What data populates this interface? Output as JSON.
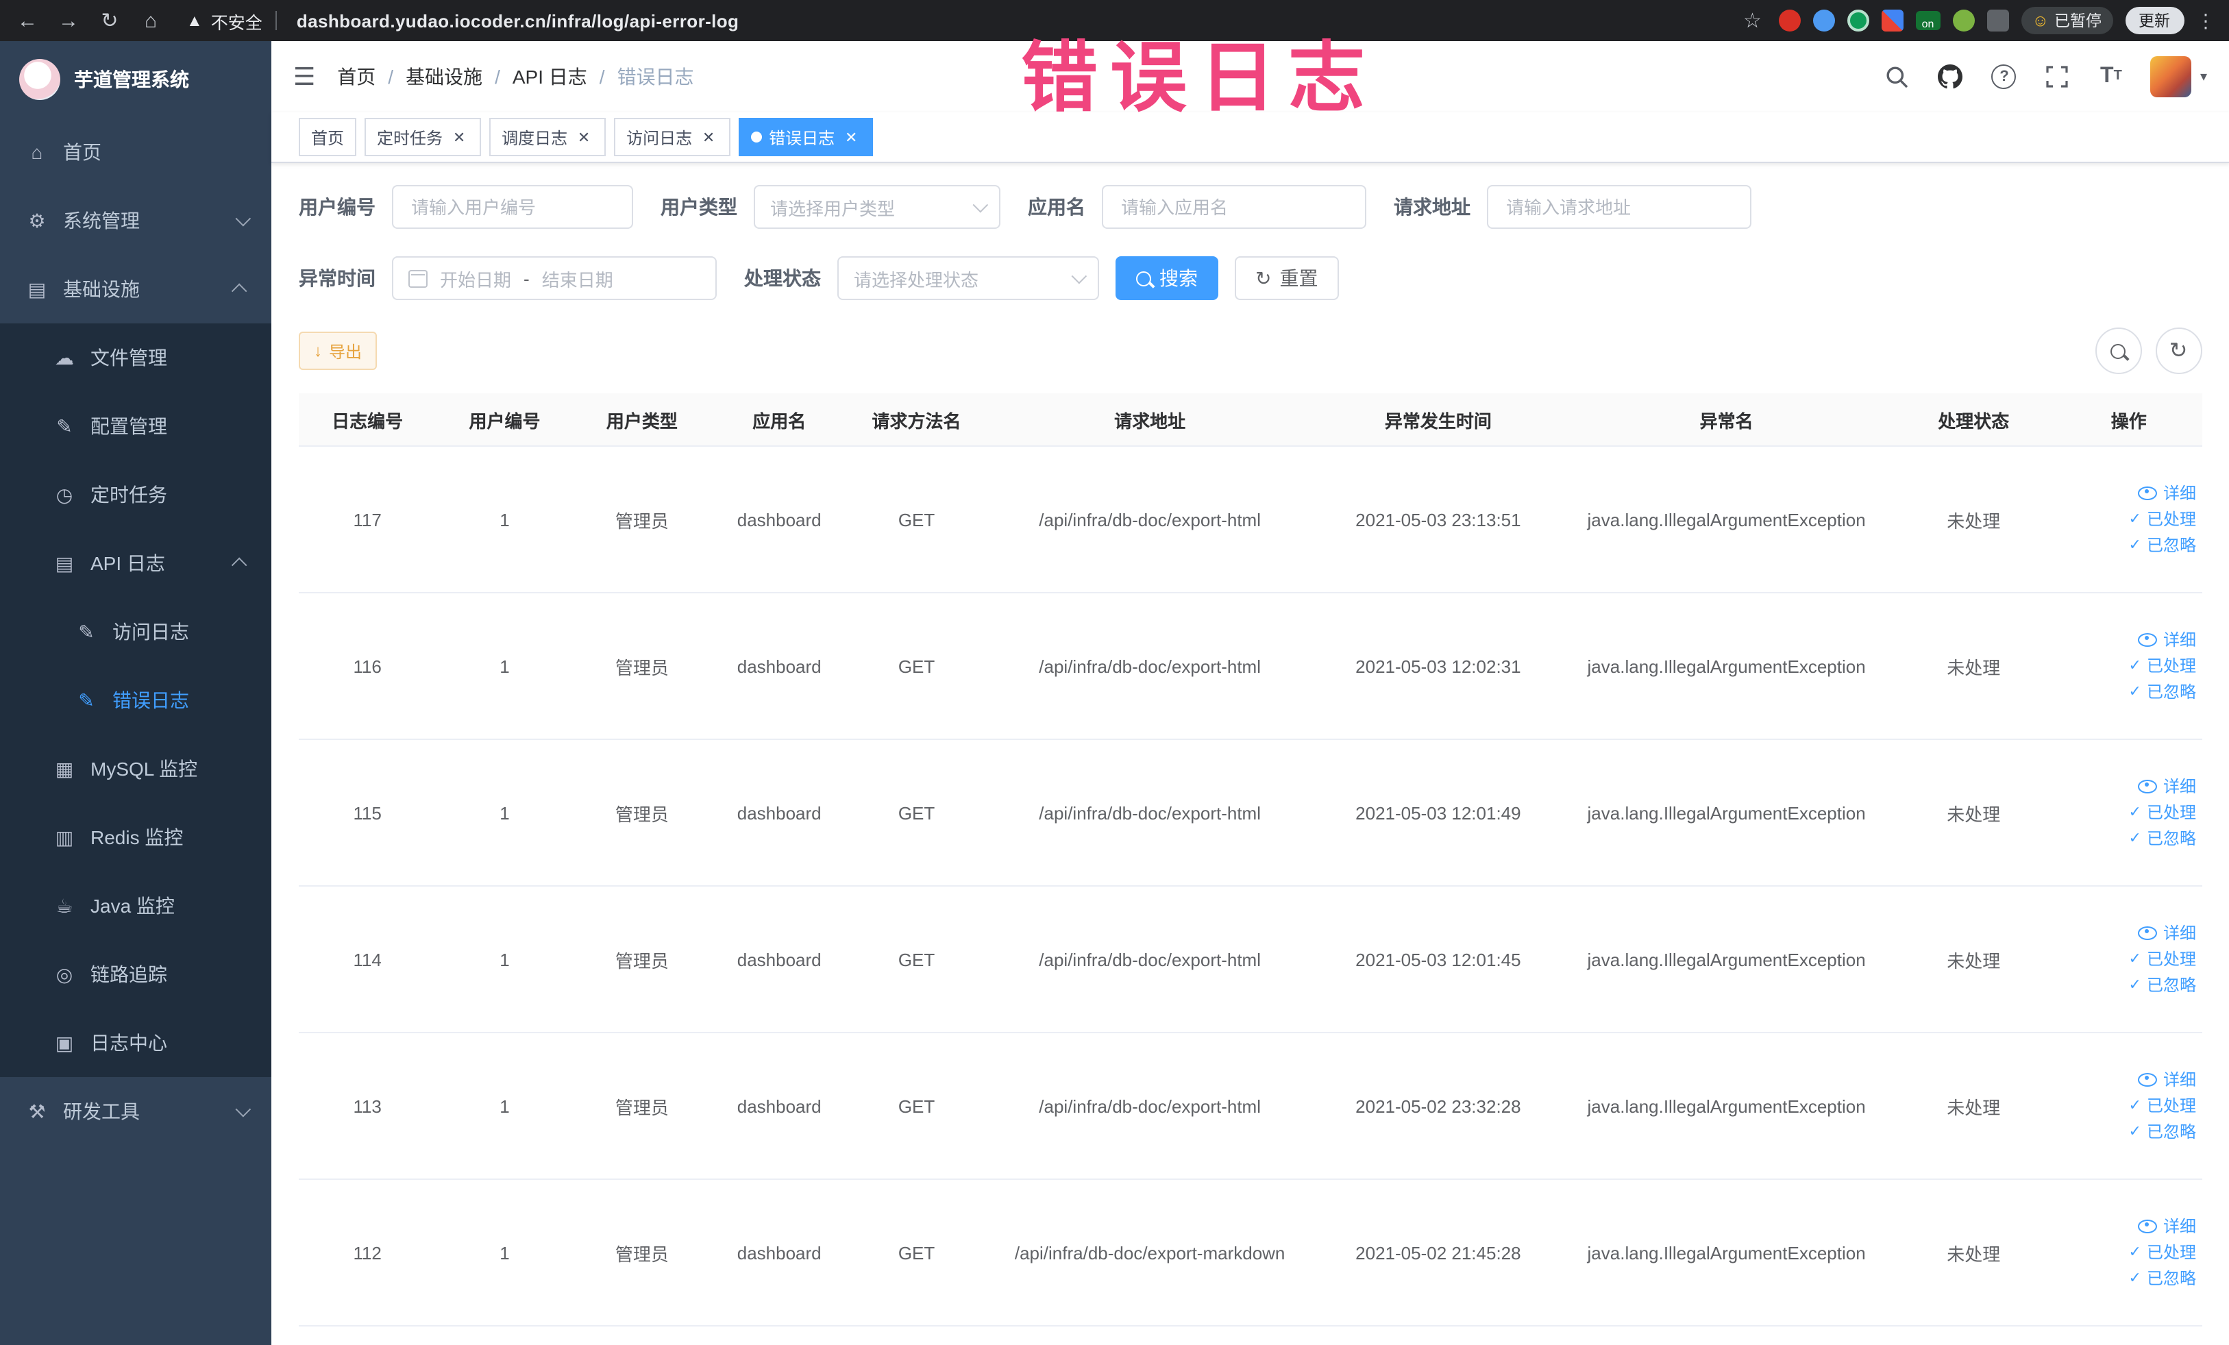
{
  "browser": {
    "security_warning": "不安全",
    "url": "dashboard.yudao.iocoder.cn/infra/log/api-error-log",
    "extension_on_badge": "on",
    "paused_badge": "已暂停",
    "update_button": "更新"
  },
  "annotation": {
    "text": "错误日志"
  },
  "sidebar": {
    "logo_title": "芋道管理系统",
    "home": "首页",
    "system": "系统管理",
    "infra": "基础设施",
    "file": "文件管理",
    "config": "配置管理",
    "job": "定时任务",
    "api_log": "API 日志",
    "access_log": "访问日志",
    "error_log": "错误日志",
    "mysql": "MySQL 监控",
    "redis": "Redis 监控",
    "java": "Java 监控",
    "trace": "链路追踪",
    "log_center": "日志中心",
    "dev_tools": "研发工具"
  },
  "header": {
    "breadcrumb": [
      "首页",
      "基础设施",
      "API 日志",
      "错误日志"
    ],
    "sep": "/"
  },
  "tabs": [
    {
      "label": "首页"
    },
    {
      "label": "定时任务"
    },
    {
      "label": "调度日志"
    },
    {
      "label": "访问日志"
    },
    {
      "label": "错误日志"
    }
  ],
  "filters": {
    "user_id": {
      "label": "用户编号",
      "placeholder": "请输入用户编号"
    },
    "user_type": {
      "label": "用户类型",
      "placeholder": "请选择用户类型"
    },
    "app_name": {
      "label": "应用名",
      "placeholder": "请输入应用名"
    },
    "request_url": {
      "label": "请求地址",
      "placeholder": "请输入请求地址"
    },
    "exception_time": {
      "label": "异常时间",
      "start": "开始日期",
      "separator": "-",
      "end": "结束日期"
    },
    "process_status": {
      "label": "处理状态",
      "placeholder": "请选择处理状态"
    },
    "search_button": "搜索",
    "reset_button": "重置"
  },
  "toolbar": {
    "export_button": "导出"
  },
  "table": {
    "columns": [
      "日志编号",
      "用户编号",
      "用户类型",
      "应用名",
      "请求方法名",
      "请求地址",
      "异常发生时间",
      "异常名",
      "处理状态",
      "操作"
    ],
    "actions": {
      "detail": "详细",
      "processed": "已处理",
      "ignored": "已忽略"
    },
    "rows": [
      {
        "log_id": "117",
        "user_id": "1",
        "user_type": "管理员",
        "app_name": "dashboard",
        "method": "GET",
        "url": "/api/infra/db-doc/export-html",
        "time": "2021-05-03 23:13:51",
        "exception": "java.lang.IllegalArgumentException",
        "status": "未处理"
      },
      {
        "log_id": "116",
        "user_id": "1",
        "user_type": "管理员",
        "app_name": "dashboard",
        "method": "GET",
        "url": "/api/infra/db-doc/export-html",
        "time": "2021-05-03 12:02:31",
        "exception": "java.lang.IllegalArgumentException",
        "status": "未处理"
      },
      {
        "log_id": "115",
        "user_id": "1",
        "user_type": "管理员",
        "app_name": "dashboard",
        "method": "GET",
        "url": "/api/infra/db-doc/export-html",
        "time": "2021-05-03 12:01:49",
        "exception": "java.lang.IllegalArgumentException",
        "status": "未处理"
      },
      {
        "log_id": "114",
        "user_id": "1",
        "user_type": "管理员",
        "app_name": "dashboard",
        "method": "GET",
        "url": "/api/infra/db-doc/export-html",
        "time": "2021-05-03 12:01:45",
        "exception": "java.lang.IllegalArgumentException",
        "status": "未处理"
      },
      {
        "log_id": "113",
        "user_id": "1",
        "user_type": "管理员",
        "app_name": "dashboard",
        "method": "GET",
        "url": "/api/infra/db-doc/export-html",
        "time": "2021-05-02 23:32:28",
        "exception": "java.lang.IllegalArgumentException",
        "status": "未处理"
      },
      {
        "log_id": "112",
        "user_id": "1",
        "user_type": "管理员",
        "app_name": "dashboard",
        "method": "GET",
        "url": "/api/infra/db-doc/export-markdown",
        "time": "2021-05-02 21:45:28",
        "exception": "java.lang.IllegalArgumentException",
        "status": "未处理"
      }
    ]
  }
}
